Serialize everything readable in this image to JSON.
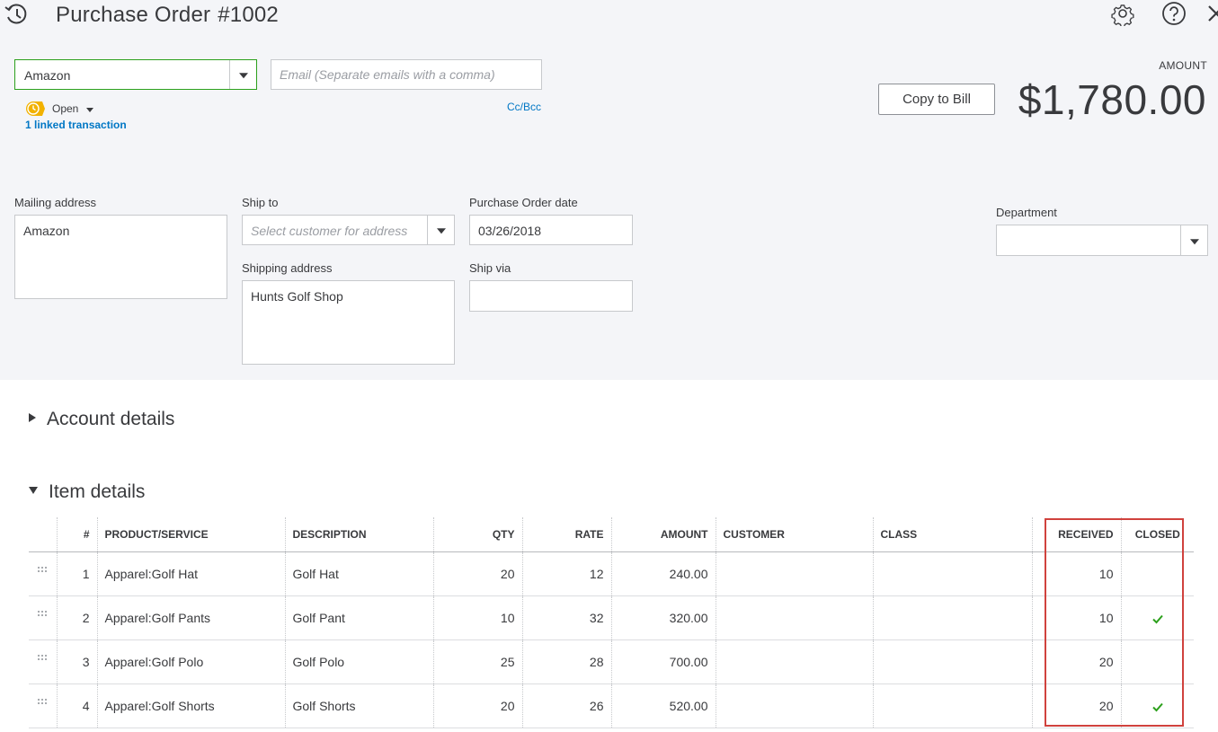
{
  "header": {
    "title": "Purchase Order",
    "number": "#1002"
  },
  "vendor": {
    "value": "Amazon"
  },
  "email": {
    "placeholder": "Email (Separate emails with a comma)"
  },
  "cc_bcc_label": "Cc/Bcc",
  "status": {
    "label": "Open",
    "linked": "1 linked transaction"
  },
  "amount": {
    "label": "AMOUNT",
    "value": "$1,780.00"
  },
  "copy_button": "Copy to Bill",
  "fields": {
    "mailing_address": {
      "label": "Mailing address",
      "value": "Amazon"
    },
    "ship_to": {
      "label": "Ship to",
      "placeholder": "Select customer for address"
    },
    "shipping_address": {
      "label": "Shipping address",
      "value": "Hunts Golf Shop"
    },
    "po_date": {
      "label": "Purchase Order date",
      "value": "03/26/2018"
    },
    "ship_via": {
      "label": "Ship via",
      "value": ""
    },
    "department": {
      "label": "Department",
      "value": ""
    }
  },
  "sections": {
    "account_details": "Account details",
    "item_details": "Item details"
  },
  "table": {
    "columns": [
      "#",
      "PRODUCT/SERVICE",
      "DESCRIPTION",
      "QTY",
      "RATE",
      "AMOUNT",
      "CUSTOMER",
      "CLASS",
      "RECEIVED",
      "CLOSED"
    ],
    "rows": [
      {
        "n": "1",
        "product": "Apparel:Golf Hat",
        "description": "Golf Hat",
        "qty": "20",
        "rate": "12",
        "amount": "240.00",
        "customer": "",
        "class": "",
        "received": "10",
        "closed": false
      },
      {
        "n": "2",
        "product": "Apparel:Golf Pants",
        "description": "Golf Pant",
        "qty": "10",
        "rate": "32",
        "amount": "320.00",
        "customer": "",
        "class": "",
        "received": "10",
        "closed": true
      },
      {
        "n": "3",
        "product": "Apparel:Golf Polo",
        "description": "Golf Polo",
        "qty": "25",
        "rate": "28",
        "amount": "700.00",
        "customer": "",
        "class": "",
        "received": "20",
        "closed": false
      },
      {
        "n": "4",
        "product": "Apparel:Golf Shorts",
        "description": "Golf Shorts",
        "qty": "20",
        "rate": "26",
        "amount": "520.00",
        "customer": "",
        "class": "",
        "received": "20",
        "closed": true
      }
    ]
  },
  "colors": {
    "accent_green": "#2ca01c",
    "link_blue": "#0077c5",
    "highlight_red": "#d0423d",
    "status_yellow": "#f2b200"
  },
  "icons": {
    "history": "history-icon",
    "settings": "gear-icon",
    "help": "help-icon",
    "close": "close-icon",
    "status": "clock-icon",
    "closed": "check-icon"
  }
}
